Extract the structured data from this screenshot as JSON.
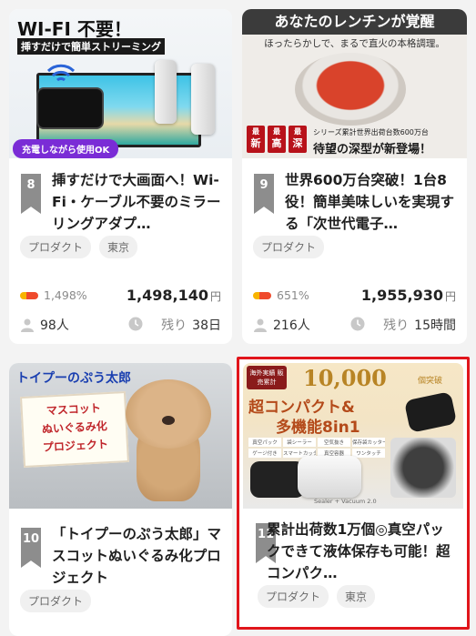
{
  "cards": [
    {
      "rank": "8",
      "title": "挿すだけで大画面へ！Wi-Fi・ケーブル不要のミラーリングアダプ…",
      "tags": [
        "プロダクト",
        "東京"
      ],
      "percent": "1,498%",
      "progress_fraction": 1.0,
      "amount": "1,498,140",
      "currency": "円",
      "supporters": "98人",
      "remaining_label": "残り",
      "remaining_value": "38日",
      "image": {
        "headline": "WI-FI 不要！",
        "subline": "挿すだけで簡単ストリーミング",
        "badge": "充電しながら使用OK"
      }
    },
    {
      "rank": "9",
      "title": "世界600万台突破！1台8役！簡単美味しいを実現する「次世代電子…",
      "tags": [
        "プロダクト"
      ],
      "percent": "651%",
      "progress_fraction": 1.0,
      "amount": "1,955,930",
      "currency": "円",
      "supporters": "216人",
      "remaining_label": "残り",
      "remaining_value": "15時間",
      "image": {
        "headline": "あなたのレンチンが覚醒",
        "subline": "ほったらかしで、まるで直火の本格調理。",
        "badge1": "最",
        "badge1b": "新",
        "badge2": "最",
        "badge2b": "高",
        "badge3": "最",
        "badge3b": "深",
        "caption_small": "シリーズ累計世界出荷台数600万台",
        "caption": "待望の深型が新登場！"
      }
    },
    {
      "rank": "10",
      "title": "「トイプーのぷう太郎」マスコットぬいぐるみ化プロジェクト",
      "tags": [
        "プロダクト"
      ],
      "image": {
        "logo": "トイプーのぷう太郎",
        "sign_lines": [
          "マスコット",
          "ぬいぐるみ化",
          "プロジェクト"
        ]
      }
    },
    {
      "rank": "11",
      "title": "累計出荷数1万個◎真空パックできて液体保存も可能！超コンパク…",
      "tags": [
        "プロダクト",
        "東京"
      ],
      "image": {
        "seal": "海外実績 販売累計",
        "big_number": "10,000",
        "unit": "個突破",
        "headline1": "超コンパクト&",
        "headline2": "多機能8in1",
        "product": "Sealer + Vacuum 2.0",
        "features": [
          "真空パック",
          "袋シーラー",
          "空気抜き",
          "保存袋カッター",
          "ゲージ付き",
          "スマートカッター",
          "真空容器",
          "ワンタッチ"
        ]
      }
    }
  ]
}
